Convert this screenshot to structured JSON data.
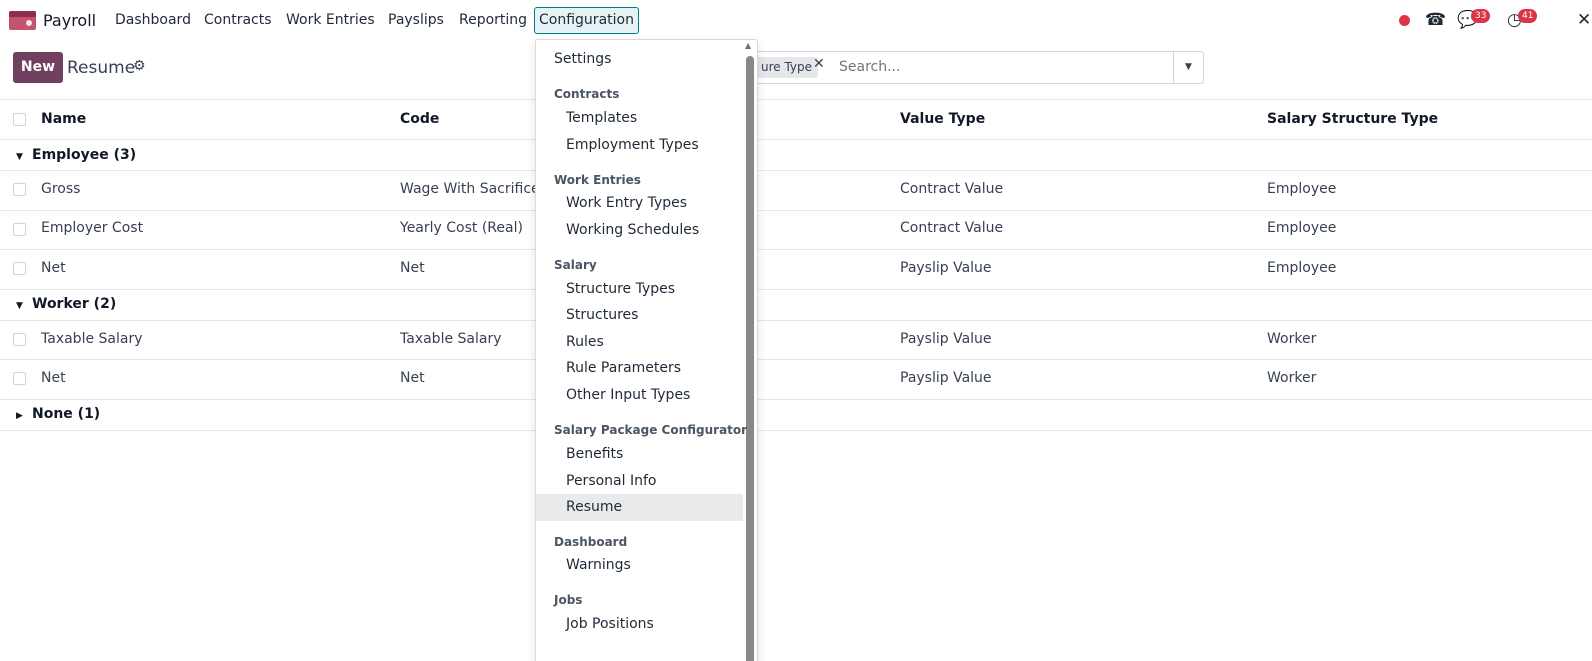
{
  "navbar": {
    "app_name": "Payroll",
    "menus": [
      "Dashboard",
      "Contracts",
      "Work Entries",
      "Payslips",
      "Reporting"
    ],
    "active_menu": "Configuration",
    "chat_badge": "33",
    "activity_badge": "41"
  },
  "control_panel": {
    "new_label": "New",
    "breadcrumb": "Resume",
    "facet_label": "Salary Structure Type",
    "facet_visible": "ure Type",
    "search_placeholder": "Search..."
  },
  "list": {
    "columns": [
      "Name",
      "Code",
      "Value Type",
      "Salary Structure Type"
    ],
    "groups": [
      {
        "label": "Employee (3)",
        "rows": [
          {
            "name": "Gross",
            "code": "Wage With Sacrifices",
            "value_type": "Contract Value",
            "structure_type": "Employee"
          },
          {
            "name": "Employer Cost",
            "code": "Yearly Cost (Real)",
            "value_type": "Contract Value",
            "structure_type": "Employee"
          },
          {
            "name": "Net",
            "code": "Net",
            "value_type": "Payslip Value",
            "structure_type": "Employee"
          }
        ]
      },
      {
        "label": "Worker (2)",
        "rows": [
          {
            "name": "Taxable Salary",
            "code": "Taxable Salary",
            "value_type": "Payslip Value",
            "structure_type": "Worker"
          },
          {
            "name": "Net",
            "code": "Net",
            "value_type": "Payslip Value",
            "structure_type": "Worker"
          }
        ]
      },
      {
        "label": "None (1)",
        "rows": []
      }
    ]
  },
  "config_menu": {
    "settings": "Settings",
    "sections": [
      {
        "title": "Contracts",
        "items": [
          "Templates",
          "Employment Types"
        ]
      },
      {
        "title": "Work Entries",
        "items": [
          "Work Entry Types",
          "Working Schedules"
        ]
      },
      {
        "title": "Salary",
        "items": [
          "Structure Types",
          "Structures",
          "Rules",
          "Rule Parameters",
          "Other Input Types"
        ]
      },
      {
        "title": "Salary Package Configurator",
        "items": [
          "Benefits",
          "Personal Info",
          "Resume"
        ]
      },
      {
        "title": "Dashboard",
        "items": [
          "Warnings"
        ]
      },
      {
        "title": "Jobs",
        "items": [
          "Job Positions"
        ]
      }
    ],
    "active_item": "Resume"
  },
  "colors": {
    "brand": "#71405f",
    "accent": "#017e84",
    "badge": "#dc3545"
  }
}
